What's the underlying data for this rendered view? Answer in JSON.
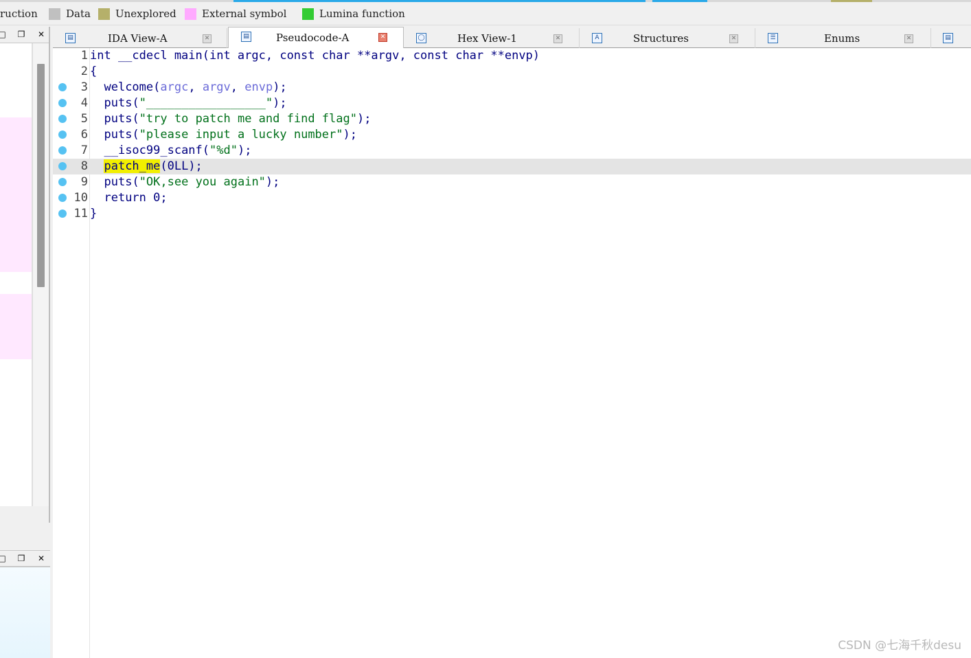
{
  "legend": {
    "items": [
      {
        "label": "ruction",
        "color": ""
      },
      {
        "label": "Data",
        "color": "#c0c0c0"
      },
      {
        "label": "Unexplored",
        "color": "#b5b06a"
      },
      {
        "label": "External symbol",
        "color": "#ffaaff"
      },
      {
        "label": "Lumina function",
        "color": "#33cc33"
      }
    ]
  },
  "left_panel": {
    "top_buttons": [
      "□",
      "❐",
      "✕"
    ],
    "bottom_buttons": [
      "□",
      "❐",
      "✕"
    ]
  },
  "tabs": [
    {
      "label": "IDA View-A",
      "icon": "ida-view-icon",
      "close": "✕",
      "active": false
    },
    {
      "label": "Pseudocode-A",
      "icon": "pseudocode-icon",
      "close": "✕",
      "active": true
    },
    {
      "label": "Hex View-1",
      "icon": "hex-view-icon",
      "close": "✕",
      "active": false
    },
    {
      "label": "Structures",
      "icon": "structures-icon",
      "close": "✕",
      "active": false
    },
    {
      "label": "Enums",
      "icon": "enums-icon",
      "close": "✕",
      "active": false
    }
  ],
  "code": {
    "lines": [
      {
        "num": "1",
        "breakpoint": false,
        "text": "int __cdecl main(int argc, const char **argv, const char **envp)"
      },
      {
        "num": "2",
        "breakpoint": false,
        "text": "{"
      },
      {
        "num": "3",
        "breakpoint": true,
        "fn": "welcome",
        "args": [
          "argc",
          "argv",
          "envp"
        ]
      },
      {
        "num": "4",
        "breakpoint": true,
        "fn": "puts",
        "str": "\"_________________\"",
        "tail": ");"
      },
      {
        "num": "5",
        "breakpoint": true,
        "fn": "puts",
        "str": "\"try to patch me and find flag\"",
        "tail": ");"
      },
      {
        "num": "6",
        "breakpoint": true,
        "fn": "puts",
        "str": "\"please input a lucky number\"",
        "tail": ");"
      },
      {
        "num": "7",
        "breakpoint": true,
        "fn": "__isoc99_scanf",
        "str": "\"%d\"",
        "tail": ");"
      },
      {
        "num": "8",
        "breakpoint": true,
        "highlighted": true,
        "fn": "patch_me",
        "rest": "(0LL);"
      },
      {
        "num": "9",
        "breakpoint": true,
        "fn": "puts",
        "str": "\"OK,see you again\"",
        "tail": ");"
      },
      {
        "num": "10",
        "breakpoint": true,
        "text": "return 0;"
      },
      {
        "num": "11",
        "breakpoint": true,
        "text": "}"
      }
    ]
  },
  "watermark": "CSDN @七海千秋desu"
}
